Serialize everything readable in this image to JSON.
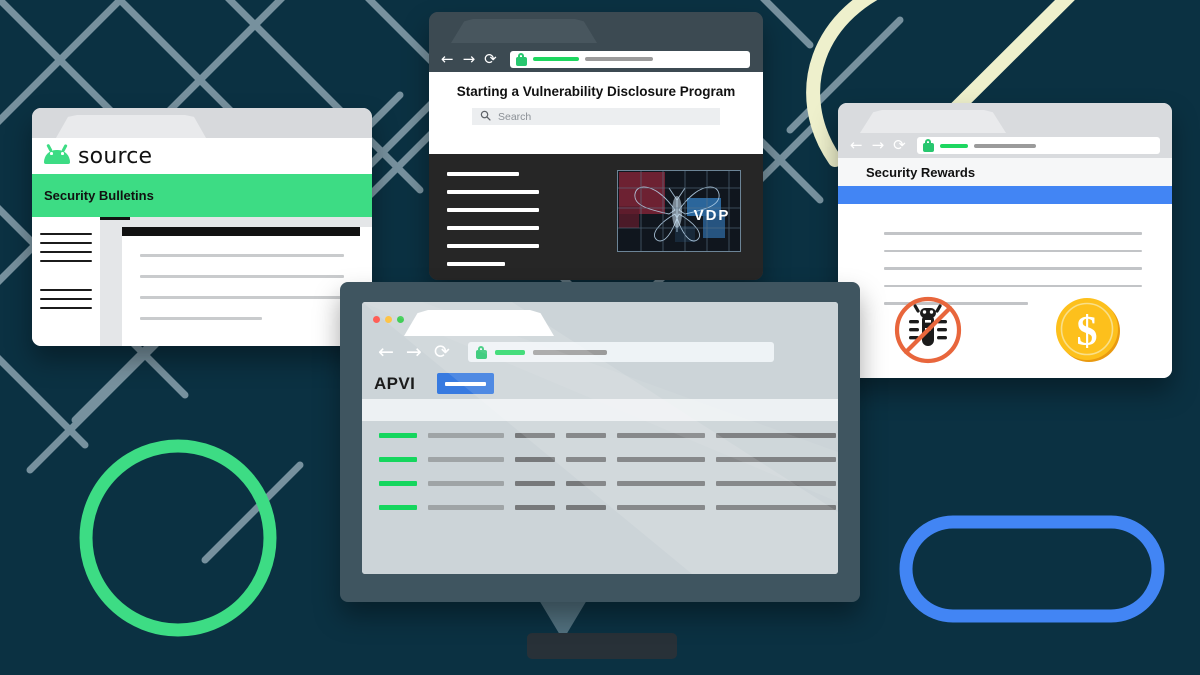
{
  "background": {
    "color": "#0b3142",
    "grid_line_color": "#7d97a3",
    "accent_green": "#3ddc84",
    "accent_blue": "#4285f4",
    "accent_cream": "#eef0cc",
    "shapes": [
      "crosshatch-grid",
      "green-circle-outline",
      "blue-rounded-rect-outline",
      "cream-curve"
    ]
  },
  "windows": {
    "android_source": {
      "brand": "source",
      "brand_icon": "android-robot-icon",
      "nav_title": "Security Bulletins",
      "accent": "#3ddc84"
    },
    "vdp": {
      "title": "Starting a Vulnerability Disclosure Program",
      "search_placeholder": "Search",
      "search_icon": "search-icon",
      "hero_label": "VDP",
      "hero_icon": "butterfly-moth-image",
      "back_icon": "arrow-left-icon",
      "forward_icon": "arrow-right-icon",
      "reload_icon": "reload-icon",
      "lock_icon": "padlock-icon"
    },
    "security_rewards": {
      "title": "Security Rewards",
      "accent": "#4285f4",
      "icons": [
        "no-bug-icon",
        "dollar-coin-icon"
      ],
      "coin_symbol": "$",
      "back_icon": "arrow-left-icon",
      "forward_icon": "arrow-right-icon",
      "reload_icon": "reload-icon",
      "lock_icon": "padlock-icon"
    }
  },
  "monitor": {
    "app_title": "APVI",
    "primary_button_label": "",
    "traffic_lights": [
      "#ff5f57",
      "#febc2e",
      "#28c840"
    ],
    "back_icon": "arrow-left-icon",
    "forward_icon": "arrow-right-icon",
    "reload_icon": "reload-icon",
    "lock_icon": "padlock-icon",
    "table_rows": 4,
    "status_color": "#15d65e"
  },
  "icons": {
    "arrow_left": "←",
    "arrow_right": "→",
    "reload": "⟳",
    "search": "⚲",
    "dollar": "$"
  }
}
